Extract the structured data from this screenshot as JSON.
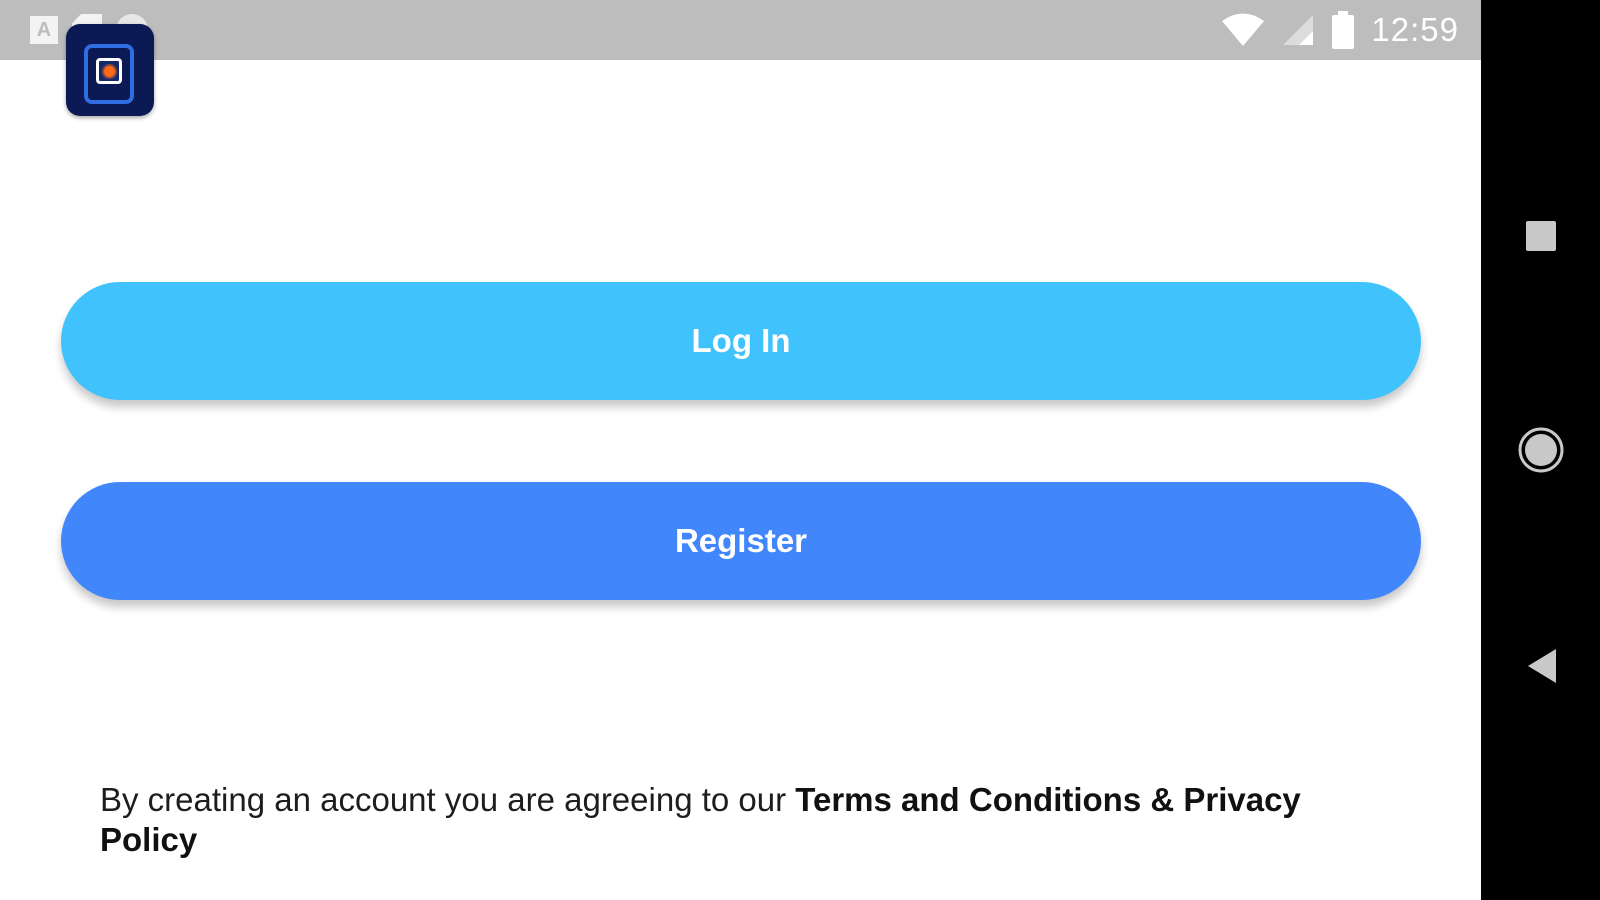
{
  "status_bar": {
    "time": "12:59",
    "notification_letter": "A",
    "icons": [
      "a-notification-icon",
      "sd-card-icon",
      "circle-notification-icon",
      "wifi-icon",
      "signal-icon",
      "battery-icon"
    ]
  },
  "app": {
    "logo_icon": "app-logo-icon"
  },
  "buttons": {
    "login_label": "Log In",
    "register_label": "Register"
  },
  "terms": {
    "prefix": "By creating an account you are agreeing to our ",
    "link": "Terms and Conditions & Privacy Policy"
  },
  "nav": {
    "icons": [
      "recents-icon",
      "home-icon",
      "back-icon"
    ]
  },
  "colors": {
    "status_bar": "#bdbdbd",
    "login_button": "#40c3fd",
    "register_button": "#4286fb",
    "nav_bar": "#000000"
  }
}
